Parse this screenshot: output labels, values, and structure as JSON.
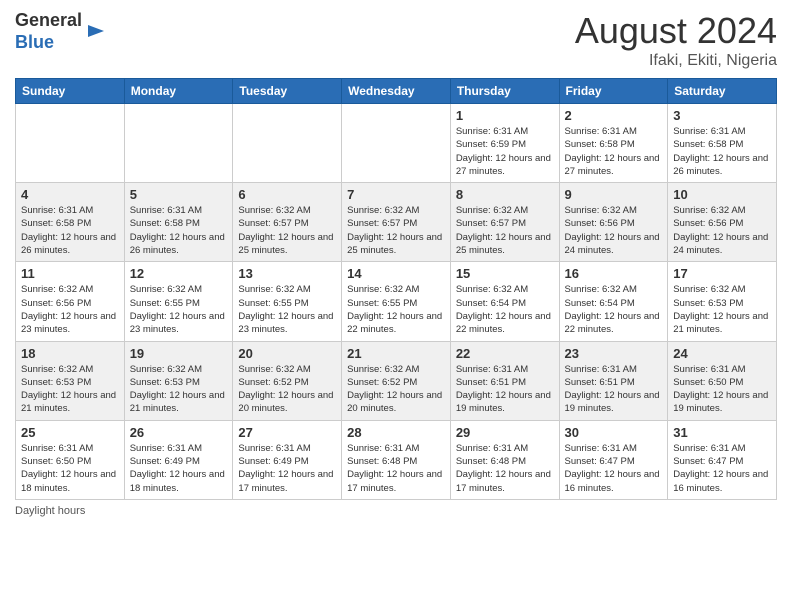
{
  "header": {
    "logo_general": "General",
    "logo_blue": "Blue",
    "month_year": "August 2024",
    "location": "Ifaki, Ekiti, Nigeria"
  },
  "days_of_week": [
    "Sunday",
    "Monday",
    "Tuesday",
    "Wednesday",
    "Thursday",
    "Friday",
    "Saturday"
  ],
  "weeks": [
    [
      {
        "day": "",
        "info": ""
      },
      {
        "day": "",
        "info": ""
      },
      {
        "day": "",
        "info": ""
      },
      {
        "day": "",
        "info": ""
      },
      {
        "day": "1",
        "info": "Sunrise: 6:31 AM\nSunset: 6:59 PM\nDaylight: 12 hours\nand 27 minutes."
      },
      {
        "day": "2",
        "info": "Sunrise: 6:31 AM\nSunset: 6:58 PM\nDaylight: 12 hours\nand 27 minutes."
      },
      {
        "day": "3",
        "info": "Sunrise: 6:31 AM\nSunset: 6:58 PM\nDaylight: 12 hours\nand 26 minutes."
      }
    ],
    [
      {
        "day": "4",
        "info": "Sunrise: 6:31 AM\nSunset: 6:58 PM\nDaylight: 12 hours\nand 26 minutes."
      },
      {
        "day": "5",
        "info": "Sunrise: 6:31 AM\nSunset: 6:58 PM\nDaylight: 12 hours\nand 26 minutes."
      },
      {
        "day": "6",
        "info": "Sunrise: 6:32 AM\nSunset: 6:57 PM\nDaylight: 12 hours\nand 25 minutes."
      },
      {
        "day": "7",
        "info": "Sunrise: 6:32 AM\nSunset: 6:57 PM\nDaylight: 12 hours\nand 25 minutes."
      },
      {
        "day": "8",
        "info": "Sunrise: 6:32 AM\nSunset: 6:57 PM\nDaylight: 12 hours\nand 25 minutes."
      },
      {
        "day": "9",
        "info": "Sunrise: 6:32 AM\nSunset: 6:56 PM\nDaylight: 12 hours\nand 24 minutes."
      },
      {
        "day": "10",
        "info": "Sunrise: 6:32 AM\nSunset: 6:56 PM\nDaylight: 12 hours\nand 24 minutes."
      }
    ],
    [
      {
        "day": "11",
        "info": "Sunrise: 6:32 AM\nSunset: 6:56 PM\nDaylight: 12 hours\nand 23 minutes."
      },
      {
        "day": "12",
        "info": "Sunrise: 6:32 AM\nSunset: 6:55 PM\nDaylight: 12 hours\nand 23 minutes."
      },
      {
        "day": "13",
        "info": "Sunrise: 6:32 AM\nSunset: 6:55 PM\nDaylight: 12 hours\nand 23 minutes."
      },
      {
        "day": "14",
        "info": "Sunrise: 6:32 AM\nSunset: 6:55 PM\nDaylight: 12 hours\nand 22 minutes."
      },
      {
        "day": "15",
        "info": "Sunrise: 6:32 AM\nSunset: 6:54 PM\nDaylight: 12 hours\nand 22 minutes."
      },
      {
        "day": "16",
        "info": "Sunrise: 6:32 AM\nSunset: 6:54 PM\nDaylight: 12 hours\nand 22 minutes."
      },
      {
        "day": "17",
        "info": "Sunrise: 6:32 AM\nSunset: 6:53 PM\nDaylight: 12 hours\nand 21 minutes."
      }
    ],
    [
      {
        "day": "18",
        "info": "Sunrise: 6:32 AM\nSunset: 6:53 PM\nDaylight: 12 hours\nand 21 minutes."
      },
      {
        "day": "19",
        "info": "Sunrise: 6:32 AM\nSunset: 6:53 PM\nDaylight: 12 hours\nand 21 minutes."
      },
      {
        "day": "20",
        "info": "Sunrise: 6:32 AM\nSunset: 6:52 PM\nDaylight: 12 hours\nand 20 minutes."
      },
      {
        "day": "21",
        "info": "Sunrise: 6:32 AM\nSunset: 6:52 PM\nDaylight: 12 hours\nand 20 minutes."
      },
      {
        "day": "22",
        "info": "Sunrise: 6:31 AM\nSunset: 6:51 PM\nDaylight: 12 hours\nand 19 minutes."
      },
      {
        "day": "23",
        "info": "Sunrise: 6:31 AM\nSunset: 6:51 PM\nDaylight: 12 hours\nand 19 minutes."
      },
      {
        "day": "24",
        "info": "Sunrise: 6:31 AM\nSunset: 6:50 PM\nDaylight: 12 hours\nand 19 minutes."
      }
    ],
    [
      {
        "day": "25",
        "info": "Sunrise: 6:31 AM\nSunset: 6:50 PM\nDaylight: 12 hours\nand 18 minutes."
      },
      {
        "day": "26",
        "info": "Sunrise: 6:31 AM\nSunset: 6:49 PM\nDaylight: 12 hours\nand 18 minutes."
      },
      {
        "day": "27",
        "info": "Sunrise: 6:31 AM\nSunset: 6:49 PM\nDaylight: 12 hours\nand 17 minutes."
      },
      {
        "day": "28",
        "info": "Sunrise: 6:31 AM\nSunset: 6:48 PM\nDaylight: 12 hours\nand 17 minutes."
      },
      {
        "day": "29",
        "info": "Sunrise: 6:31 AM\nSunset: 6:48 PM\nDaylight: 12 hours\nand 17 minutes."
      },
      {
        "day": "30",
        "info": "Sunrise: 6:31 AM\nSunset: 6:47 PM\nDaylight: 12 hours\nand 16 minutes."
      },
      {
        "day": "31",
        "info": "Sunrise: 6:31 AM\nSunset: 6:47 PM\nDaylight: 12 hours\nand 16 minutes."
      }
    ]
  ],
  "footer": {
    "daylight_label": "Daylight hours"
  }
}
